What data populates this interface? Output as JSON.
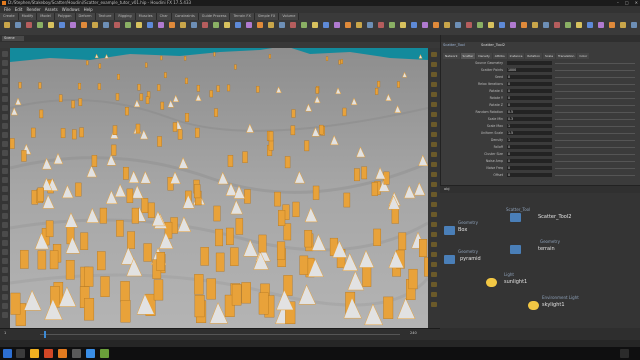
{
  "window": {
    "title": "D:/Stephen/Stakeboy/Scatter/Houdini/Scatter_example_tutor_v01.hip - Houdini FX 17.5.433"
  },
  "menubar": {
    "items": [
      "File",
      "Edit",
      "Render",
      "Assets",
      "Windows",
      "Help"
    ]
  },
  "shelf": {
    "tabs": [
      "Create",
      "Modify",
      "Model",
      "Polygon",
      "Deform",
      "Texture",
      "Rigging",
      "Muscles",
      "Char",
      "Constraints",
      "Guide Process",
      "Terrain FX",
      "Simple FX",
      "Volume"
    ]
  },
  "viewer": {
    "tab_label": "Scene",
    "left_tool_count": 30,
    "right_tool_count": 26
  },
  "timeline": {
    "start_frame": "1",
    "end_frame": "240"
  },
  "params": {
    "node_type": "Scatter_Tool",
    "node_name": "Scatter_Tool2",
    "tabs": [
      "Network",
      "Scatter",
      "Density",
      "Attribs",
      "Instance",
      "Rotation",
      "Scale",
      "Translation",
      "Color"
    ],
    "rows": [
      {
        "label": "Source Geometry",
        "value": ""
      },
      {
        "label": "Scatter Points",
        "value": "1000"
      },
      {
        "label": "Seed",
        "value": "0"
      },
      {
        "label": "Relax Iterations",
        "value": "0"
      },
      {
        "label": "Rotate X",
        "value": "0"
      },
      {
        "label": "Rotate Y",
        "value": "0"
      },
      {
        "label": "Rotate Z",
        "value": "0"
      },
      {
        "label": "Random Rotation",
        "value": "0.5"
      },
      {
        "label": "Scale Min",
        "value": "0.3"
      },
      {
        "label": "Scale Max",
        "value": "1"
      },
      {
        "label": "Uniform Scale",
        "value": "1.5"
      },
      {
        "label": "Density",
        "value": "1"
      },
      {
        "label": "Falloff",
        "value": "0"
      },
      {
        "label": "Cluster Size",
        "value": "0"
      },
      {
        "label": "Noise Amp",
        "value": "0"
      },
      {
        "label": "Noise Freq",
        "value": "0"
      },
      {
        "label": "Offset",
        "value": "0"
      }
    ]
  },
  "network": {
    "path": "obj",
    "nodes": [
      {
        "type": "Scatter_Tool",
        "name": "Scatter_Tool2",
        "color": "#4a7fb8"
      },
      {
        "type": "Geometry",
        "name": "Box",
        "color": "#4a7fb8"
      },
      {
        "type": "Geometry",
        "name": "terrain",
        "color": "#4a7fb8"
      },
      {
        "type": "Geometry",
        "name": "pyramid",
        "color": "#4a7fb8"
      },
      {
        "type": "Light",
        "name": "sunlight1",
        "color": "#f2c744"
      },
      {
        "type": "Environment Light",
        "name": "skylight1",
        "color": "#f2c744"
      }
    ]
  },
  "colors": {
    "accent": "#e8a23a",
    "sea": "#138a9c",
    "terrain": "#a4a4a4"
  }
}
